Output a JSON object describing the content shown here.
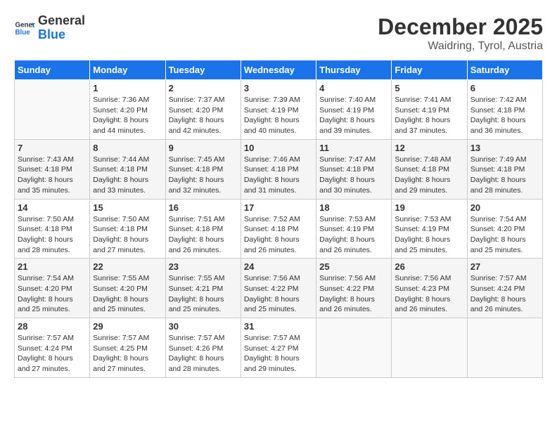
{
  "header": {
    "logo": {
      "general": "General",
      "blue": "Blue"
    },
    "title": "December 2025",
    "subtitle": "Waidring, Tyrol, Austria"
  },
  "days_of_week": [
    "Sunday",
    "Monday",
    "Tuesday",
    "Wednesday",
    "Thursday",
    "Friday",
    "Saturday"
  ],
  "weeks": [
    [
      {
        "day": "",
        "info": ""
      },
      {
        "day": "1",
        "info": "Sunrise: 7:36 AM\nSunset: 4:20 PM\nDaylight: 8 hours\nand 44 minutes."
      },
      {
        "day": "2",
        "info": "Sunrise: 7:37 AM\nSunset: 4:20 PM\nDaylight: 8 hours\nand 42 minutes."
      },
      {
        "day": "3",
        "info": "Sunrise: 7:39 AM\nSunset: 4:19 PM\nDaylight: 8 hours\nand 40 minutes."
      },
      {
        "day": "4",
        "info": "Sunrise: 7:40 AM\nSunset: 4:19 PM\nDaylight: 8 hours\nand 39 minutes."
      },
      {
        "day": "5",
        "info": "Sunrise: 7:41 AM\nSunset: 4:19 PM\nDaylight: 8 hours\nand 37 minutes."
      },
      {
        "day": "6",
        "info": "Sunrise: 7:42 AM\nSunset: 4:18 PM\nDaylight: 8 hours\nand 36 minutes."
      }
    ],
    [
      {
        "day": "7",
        "info": "Sunrise: 7:43 AM\nSunset: 4:18 PM\nDaylight: 8 hours\nand 35 minutes."
      },
      {
        "day": "8",
        "info": "Sunrise: 7:44 AM\nSunset: 4:18 PM\nDaylight: 8 hours\nand 33 minutes."
      },
      {
        "day": "9",
        "info": "Sunrise: 7:45 AM\nSunset: 4:18 PM\nDaylight: 8 hours\nand 32 minutes."
      },
      {
        "day": "10",
        "info": "Sunrise: 7:46 AM\nSunset: 4:18 PM\nDaylight: 8 hours\nand 31 minutes."
      },
      {
        "day": "11",
        "info": "Sunrise: 7:47 AM\nSunset: 4:18 PM\nDaylight: 8 hours\nand 30 minutes."
      },
      {
        "day": "12",
        "info": "Sunrise: 7:48 AM\nSunset: 4:18 PM\nDaylight: 8 hours\nand 29 minutes."
      },
      {
        "day": "13",
        "info": "Sunrise: 7:49 AM\nSunset: 4:18 PM\nDaylight: 8 hours\nand 28 minutes."
      }
    ],
    [
      {
        "day": "14",
        "info": "Sunrise: 7:50 AM\nSunset: 4:18 PM\nDaylight: 8 hours\nand 28 minutes."
      },
      {
        "day": "15",
        "info": "Sunrise: 7:50 AM\nSunset: 4:18 PM\nDaylight: 8 hours\nand 27 minutes."
      },
      {
        "day": "16",
        "info": "Sunrise: 7:51 AM\nSunset: 4:18 PM\nDaylight: 8 hours\nand 26 minutes."
      },
      {
        "day": "17",
        "info": "Sunrise: 7:52 AM\nSunset: 4:18 PM\nDaylight: 8 hours\nand 26 minutes."
      },
      {
        "day": "18",
        "info": "Sunrise: 7:53 AM\nSunset: 4:19 PM\nDaylight: 8 hours\nand 26 minutes."
      },
      {
        "day": "19",
        "info": "Sunrise: 7:53 AM\nSunset: 4:19 PM\nDaylight: 8 hours\nand 25 minutes."
      },
      {
        "day": "20",
        "info": "Sunrise: 7:54 AM\nSunset: 4:20 PM\nDaylight: 8 hours\nand 25 minutes."
      }
    ],
    [
      {
        "day": "21",
        "info": "Sunrise: 7:54 AM\nSunset: 4:20 PM\nDaylight: 8 hours\nand 25 minutes."
      },
      {
        "day": "22",
        "info": "Sunrise: 7:55 AM\nSunset: 4:20 PM\nDaylight: 8 hours\nand 25 minutes."
      },
      {
        "day": "23",
        "info": "Sunrise: 7:55 AM\nSunset: 4:21 PM\nDaylight: 8 hours\nand 25 minutes."
      },
      {
        "day": "24",
        "info": "Sunrise: 7:56 AM\nSunset: 4:22 PM\nDaylight: 8 hours\nand 25 minutes."
      },
      {
        "day": "25",
        "info": "Sunrise: 7:56 AM\nSunset: 4:22 PM\nDaylight: 8 hours\nand 26 minutes."
      },
      {
        "day": "26",
        "info": "Sunrise: 7:56 AM\nSunset: 4:23 PM\nDaylight: 8 hours\nand 26 minutes."
      },
      {
        "day": "27",
        "info": "Sunrise: 7:57 AM\nSunset: 4:24 PM\nDaylight: 8 hours\nand 26 minutes."
      }
    ],
    [
      {
        "day": "28",
        "info": "Sunrise: 7:57 AM\nSunset: 4:24 PM\nDaylight: 8 hours\nand 27 minutes."
      },
      {
        "day": "29",
        "info": "Sunrise: 7:57 AM\nSunset: 4:25 PM\nDaylight: 8 hours\nand 27 minutes."
      },
      {
        "day": "30",
        "info": "Sunrise: 7:57 AM\nSunset: 4:26 PM\nDaylight: 8 hours\nand 28 minutes."
      },
      {
        "day": "31",
        "info": "Sunrise: 7:57 AM\nSunset: 4:27 PM\nDaylight: 8 hours\nand 29 minutes."
      },
      {
        "day": "",
        "info": ""
      },
      {
        "day": "",
        "info": ""
      },
      {
        "day": "",
        "info": ""
      }
    ]
  ]
}
